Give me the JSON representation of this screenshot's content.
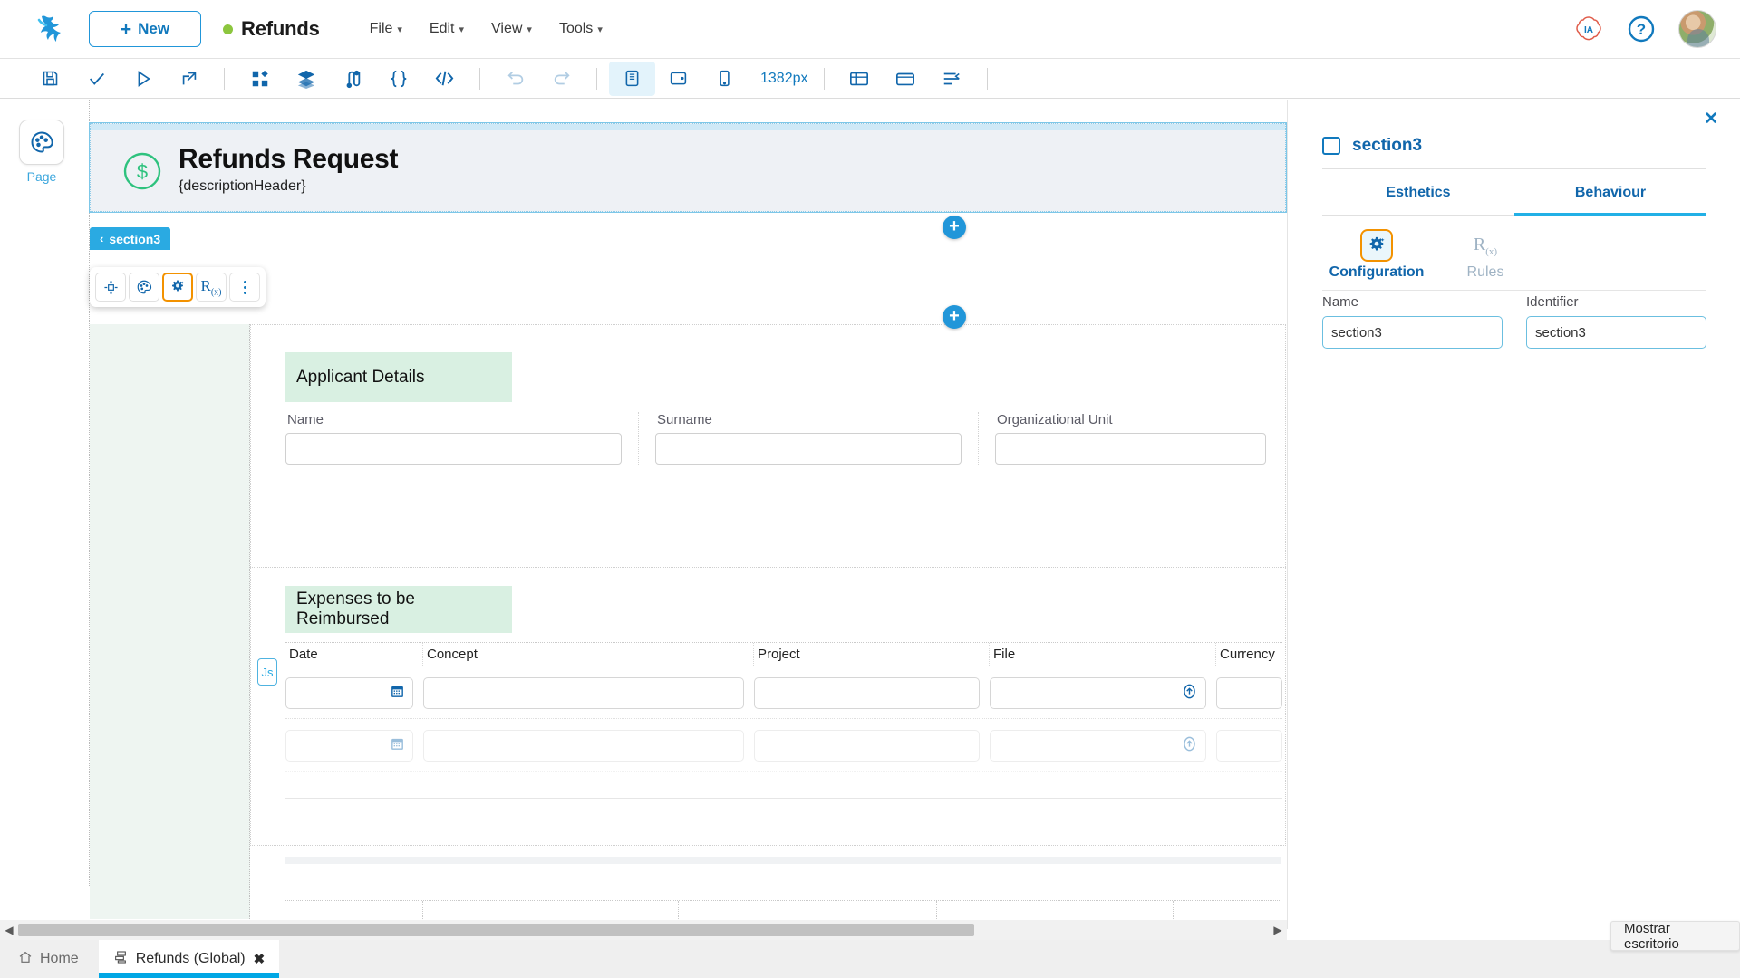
{
  "topbar": {
    "logo_icon": "frog-logo-icon",
    "new_button": {
      "label": "New",
      "plus": "+"
    },
    "app_title": "Refunds",
    "status_dot_color": "#8cc63e",
    "menus": [
      {
        "label": "File",
        "caret": "⌄"
      },
      {
        "label": "Edit",
        "caret": "⌄"
      },
      {
        "label": "View",
        "caret": "⌄"
      },
      {
        "label": "Tools",
        "caret": "⌄"
      }
    ],
    "ia_label": "IA",
    "help_label": "?",
    "avatar_name": "user-avatar"
  },
  "toolbar": {
    "zoom_value": "1382px",
    "buttons": [
      {
        "name": "save-icon"
      },
      {
        "name": "check-icon"
      },
      {
        "name": "run-icon"
      },
      {
        "name": "deploy-icon"
      },
      {
        "name": "components-icon"
      },
      {
        "name": "layers-icon"
      },
      {
        "name": "data-model-icon"
      },
      {
        "name": "braces-icon"
      },
      {
        "name": "code-icon"
      },
      {
        "name": "undo-icon"
      },
      {
        "name": "redo-icon"
      },
      {
        "name": "desktop-view-icon"
      },
      {
        "name": "tablet-view-icon"
      },
      {
        "name": "mobile-view-icon"
      },
      {
        "name": "grid-layout-icon"
      },
      {
        "name": "container-icon"
      },
      {
        "name": "align-icon"
      }
    ]
  },
  "leftrail": {
    "page_tool": {
      "label": "Page",
      "icon": "palette-icon"
    }
  },
  "canvas": {
    "header": {
      "icon": "dollar-coin-icon",
      "title": "Refunds Request",
      "subtitle": "{descriptionHeader}"
    },
    "section_tag": {
      "label": "section3",
      "chevron": "‹"
    },
    "mini_toolbar": [
      {
        "name": "move-icon"
      },
      {
        "name": "palette-icon"
      },
      {
        "name": "settings-gear-icon"
      },
      {
        "name": "rules-rx-icon"
      },
      {
        "name": "more-vertical-icon"
      }
    ],
    "applicant_section": {
      "title": "Applicant Details",
      "fields": [
        {
          "label": "Name",
          "value": "",
          "placeholder": ""
        },
        {
          "label": "Surname",
          "value": "",
          "placeholder": ""
        },
        {
          "label": "Organizational Unit",
          "value": "",
          "placeholder": ""
        }
      ]
    },
    "expenses_section": {
      "title": "Expenses to be Reimbursed",
      "js_badge": "Js",
      "columns": [
        "Date",
        "Concept",
        "Project",
        "File",
        "Currency"
      ],
      "rows": [
        {
          "date": "",
          "concept": "",
          "project": "",
          "file": "",
          "currency": ""
        },
        {
          "date": "",
          "concept": "",
          "project": "",
          "file": "",
          "currency": ""
        }
      ],
      "date_icon": "calendar-icon",
      "file_icon": "upload-icon"
    }
  },
  "right_panel": {
    "close_label": "✕",
    "title": "section3",
    "tabs": [
      {
        "label": "Esthetics",
        "active": false
      },
      {
        "label": "Behaviour",
        "active": true
      }
    ],
    "subtabs": [
      {
        "label": "Configuration",
        "icon": "settings-gear-icon",
        "active": true
      },
      {
        "label": "Rules",
        "icon": "rules-rx-icon",
        "active": false
      }
    ],
    "fields": [
      {
        "label": "Name",
        "value": "section3"
      },
      {
        "label": "Identifier",
        "value": "section3"
      }
    ],
    "accent_color": "#22b0e6",
    "selected_color": "#f39200"
  },
  "tooltip": {
    "text": "Mostrar escritorio"
  },
  "bottombar": {
    "home": {
      "label": "Home",
      "icon": "home-icon"
    },
    "tabs": [
      {
        "label": "Refunds (Global)",
        "icon": "app-icon",
        "close": "✖",
        "active": true
      }
    ]
  },
  "scrollbar": {
    "left_arrow": "◀",
    "right_arrow": "▶"
  }
}
